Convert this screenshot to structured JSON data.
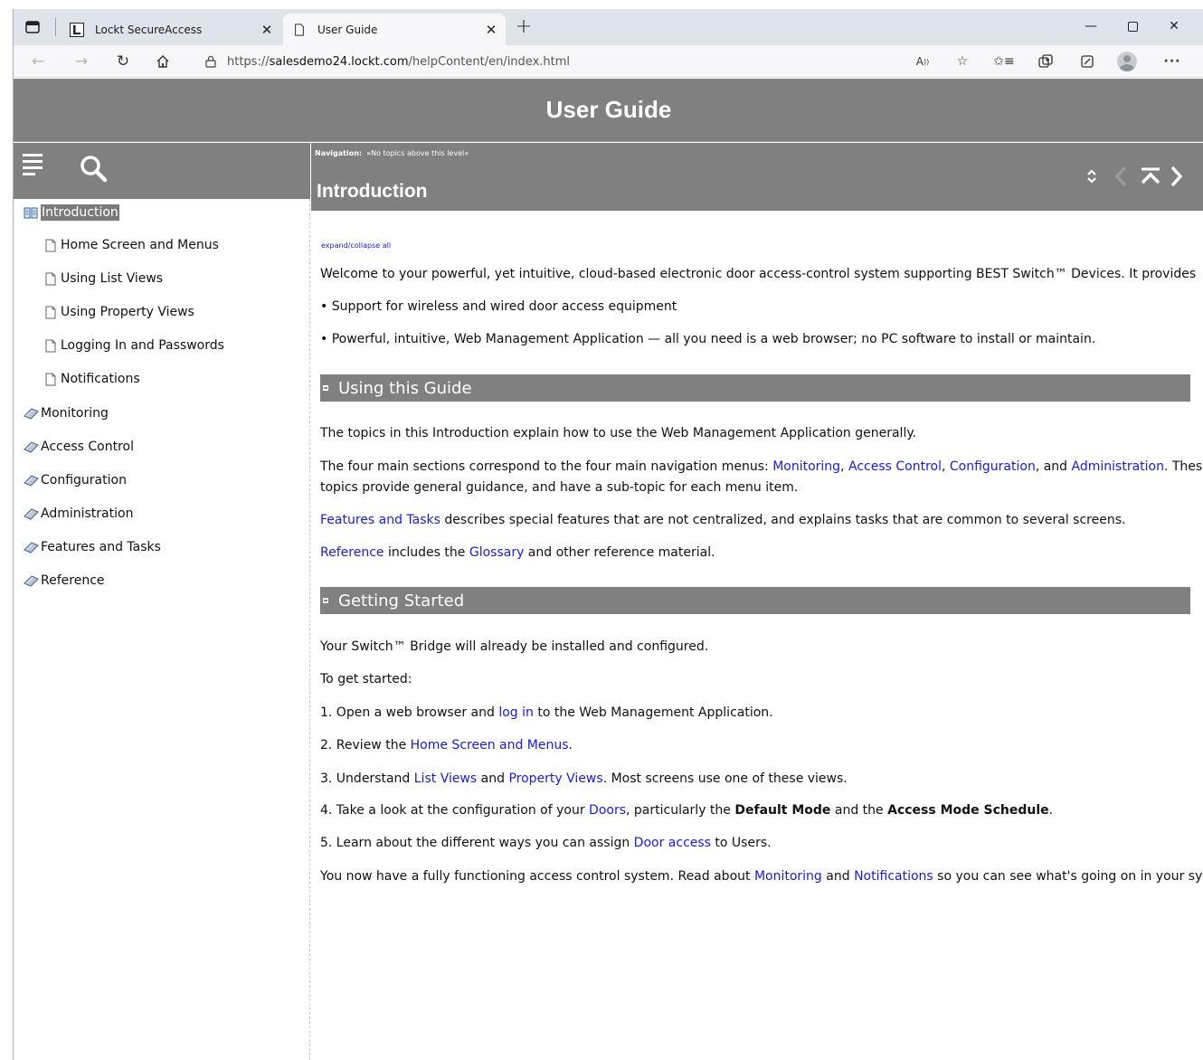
{
  "browser": {
    "tabs": [
      {
        "title": "Lockt SecureAccess",
        "active": false
      },
      {
        "title": "User Guide",
        "active": true
      }
    ],
    "url_prefix": "https://",
    "url_host": "salesdemo24.lockt.com",
    "url_path": "/helpContent/en/index.html",
    "read_aloud_label": "A̅",
    "more_label": "···"
  },
  "site": {
    "title": "User Guide"
  },
  "toc": {
    "items": [
      {
        "label": "Introduction",
        "level": 0,
        "icon": "open-book-icon",
        "selected": true
      },
      {
        "label": "Home Screen and Menus",
        "level": 1,
        "icon": "page-icon"
      },
      {
        "label": "Using List Views",
        "level": 1,
        "icon": "page-icon"
      },
      {
        "label": "Using Property Views",
        "level": 1,
        "icon": "page-icon"
      },
      {
        "label": "Logging In and Passwords",
        "level": 1,
        "icon": "page-icon"
      },
      {
        "label": "Notifications",
        "level": 1,
        "icon": "page-icon"
      },
      {
        "label": "Monitoring",
        "level": 0,
        "icon": "closed-book-icon"
      },
      {
        "label": "Access Control",
        "level": 0,
        "icon": "closed-book-icon"
      },
      {
        "label": "Configuration",
        "level": 0,
        "icon": "closed-book-icon"
      },
      {
        "label": "Administration",
        "level": 0,
        "icon": "closed-book-icon"
      },
      {
        "label": "Features and Tasks",
        "level": 0,
        "icon": "closed-book-icon"
      },
      {
        "label": "Reference",
        "level": 0,
        "icon": "closed-book-icon"
      }
    ]
  },
  "topic": {
    "nav_label": "Navigation:",
    "nav_text": "»No topics above this level«",
    "title": "Introduction",
    "expand_collapse": "expand/collapse all",
    "welcome": "Welcome to your powerful, yet intuitive, cloud-based electronic door access-control system supporting BEST Switch™ Devices.  It provides",
    "bullet1": "• Support for wireless and wired door access equipment",
    "bullet2": "• Powerful, intuitive, Web Management Application — all you need is a web browser; no PC software to install or maintain.",
    "section1_title": "Using this Guide",
    "s1_p1": "The topics in this Introduction explain how to use the Web Management Application generally.",
    "s1_p2_a": "The four main sections correspond to the four main navigation menus: ",
    "s1_p2_link1": "Monitoring",
    "s1_p2_sep1": ", ",
    "s1_p2_link2": "Access Control",
    "s1_p2_sep2": ", ",
    "s1_p2_link3": "Configuration",
    "s1_p2_sep3": ", and ",
    "s1_p2_link4": "Administration",
    "s1_p2_b": ". These",
    "s1_p2_line2": "topics provide general guidance, and have a sub-topic for each menu item.",
    "s1_p3_link": "Features and Tasks",
    "s1_p3_text": " describes special features that are not centralized, and explains tasks that are common to several screens.",
    "s1_p4_link1": "Reference",
    "s1_p4_text1": " includes the ",
    "s1_p4_link2": "Glossary",
    "s1_p4_text2": " and other reference material.",
    "section2_title": "Getting Started",
    "s2_p1": "Your Switch™ Bridge will already be installed and configured.",
    "s2_p2": "To get started:",
    "step1_a": "1.  Open a web browser and ",
    "step1_link": "log in",
    "step1_b": " to the Web Management Application.",
    "step2_a": "2.  Review the ",
    "step2_link": "Home Screen and Menus",
    "step2_b": ".",
    "step3_a": "3.  Understand ",
    "step3_link1": "List Views",
    "step3_mid": " and ",
    "step3_link2": "Property Views",
    "step3_b": ". Most screens use one of these views.",
    "step4_a": "4.  Take a look at the configuration of your ",
    "step4_link": "Doors",
    "step4_b": ", particularly the ",
    "step4_bold1": "Default Mode",
    "step4_c": " and the ",
    "step4_bold2": "Access Mode Schedule",
    "step4_d": ".",
    "step5_a": "5.  Learn about the different ways you can assign ",
    "step5_link": "Door access",
    "step5_b": " to Users.",
    "final_a": "You now have a fully functioning access control system. Read about ",
    "final_link1": "Monitoring",
    "final_mid": " and ",
    "final_link2": "Notifications",
    "final_b": " so you can see what's going on in your system."
  },
  "colors": {
    "header_gray": "#808080",
    "link_blue": "#1a1adc"
  }
}
